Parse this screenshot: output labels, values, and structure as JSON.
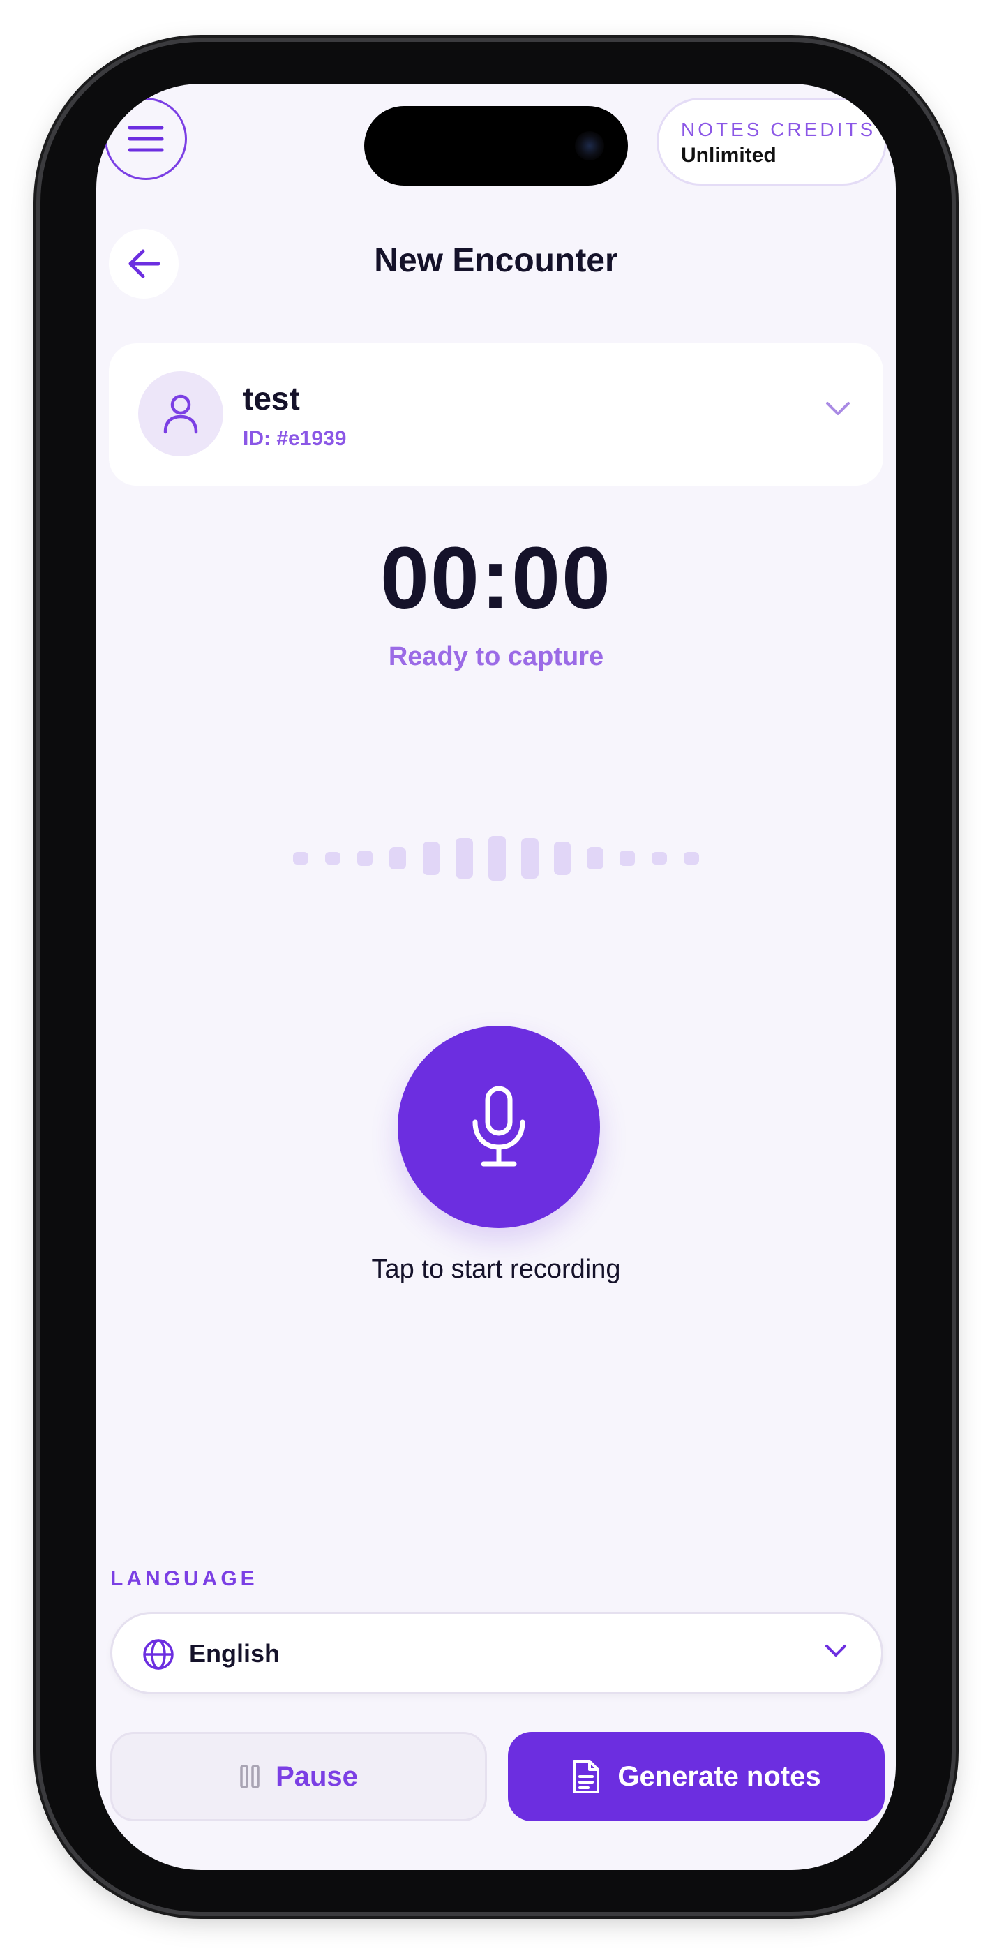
{
  "header": {
    "credits_label": "NOTES CREDITS",
    "credits_value": "Unlimited"
  },
  "page": {
    "title": "New Encounter"
  },
  "patient": {
    "name": "test",
    "id": "ID: #e1939"
  },
  "recorder": {
    "timer": "00:00",
    "status": "Ready to capture",
    "hint": "Tap to start recording"
  },
  "language": {
    "label": "LANGUAGE",
    "selected": "English"
  },
  "actions": {
    "pause_label": "Pause",
    "generate_label": "Generate notes"
  },
  "colors": {
    "accent": "#6c2ee0",
    "accent_light": "#9b6be6",
    "background": "#f7f5fc",
    "wave_bar": "#e1d6f7"
  },
  "icons": {
    "menu": "menu-icon",
    "back": "arrow-left-icon",
    "avatar": "user-icon",
    "mic": "microphone-icon",
    "globe": "globe-icon",
    "pause": "pause-icon",
    "document": "document-icon"
  }
}
